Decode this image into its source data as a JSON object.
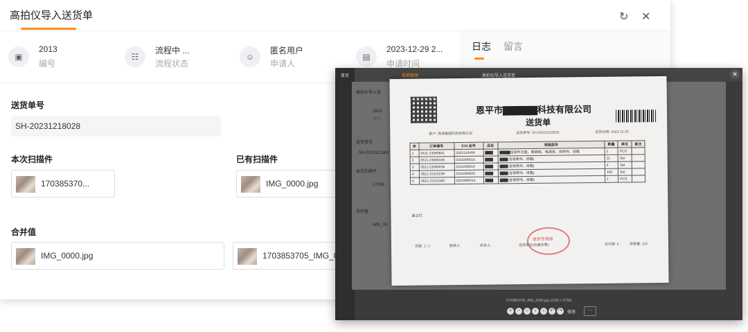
{
  "window": {
    "title": "高拍仪导入送货单",
    "refresh_icon": "refresh-icon",
    "close_icon": "close-icon"
  },
  "info": [
    {
      "value": "2013",
      "label": "编号",
      "icon": "form-icon"
    },
    {
      "value": "流程中 ...",
      "label": "流程状态",
      "icon": "flow-icon"
    },
    {
      "value": "匿名用户",
      "label": "申请人",
      "icon": "user-icon"
    },
    {
      "value": "2023-12-29 2...",
      "label": "申请时间",
      "icon": "calendar-icon"
    }
  ],
  "tabs": [
    {
      "label": "日志"
    },
    {
      "label": "留言"
    }
  ],
  "form": {
    "delivery_no_label": "送货单号",
    "delivery_no_value": "SH-20231218028",
    "current_scan_label": "本次扫描件",
    "current_scan_file": "170385370...",
    "existing_scan_label": "已有扫描件",
    "existing_scan_file": "IMG_0000.jpg",
    "merged_label": "合并值",
    "merged_files": [
      "IMG_0000.jpg",
      "1703853705_IMG_0"
    ]
  },
  "viewer": {
    "document": {
      "company": "恩平市▇▇▇▇▇科技有限公司",
      "title": "送货单",
      "customer": "客户: 珠海喜威科技有限公司",
      "delivery_no": "送货单号: SH-20231218028",
      "date": "送货日期: 2023-12-28",
      "table_headers": [
        "序",
        "订单编号",
        "E10 品号",
        "品名",
        "规格型号",
        "数量",
        "单位",
        "备注"
      ],
      "table_rows": [
        [
          "1",
          "0511-23080641",
          "2022110499",
          "▇▇▇",
          "▇▇▇▇含软件光盘、数据线、电源线、说明书、纸箱",
          "2",
          "PCS",
          ""
        ],
        [
          "2",
          "0511-23080436",
          "2011090016",
          "▇▇▇",
          "▇▇▇(含说明书、纸箱)",
          "11",
          "Set",
          ""
        ],
        [
          "3",
          "0511-23080436",
          "2011090019",
          "▇▇▇",
          "▇▇▇(含说明书、纸箱)",
          "4",
          "Set",
          ""
        ],
        [
          "4",
          "0511-23110238",
          "2011090020",
          "▇▇▇",
          "▇▇▇(含说明书、纸箱)",
          "100",
          "Set",
          ""
        ],
        [
          "5",
          "0511-23110160",
          "2022090014",
          "▇▇▇",
          "▇▇▇(含说明书、纸箱)",
          "1",
          "PCS",
          ""
        ]
      ],
      "remarks": "备注栏:",
      "page": "页数: 1 / 1",
      "maker": "制单人:",
      "receiver": "收货人:",
      "sender": "送货单位(加盖印章):",
      "stamp": "送货专用章",
      "total_rows": "总行数: 5",
      "total_qty": "总数量: 118"
    },
    "caption": "1703853705_IMG_0000.jpg (2100 × 2790)",
    "edit_label": "修改",
    "more_label": "···",
    "bg_title": "高拍仪导入送",
    "bg_no": "2013",
    "bg_no_label": "编号",
    "bg_delivery_label": "送货单号",
    "bg_delivery_value": "SH-2023121802",
    "bg_scan_label": "本次扫描件",
    "bg_scan_file": "17038",
    "bg_merged_label": "合并值",
    "bg_merged_file": "IMG_00",
    "bg_page": "首页",
    "bg_menu": "采购管理",
    "bg_tab": "高拍仪导入送货单"
  },
  "colors": {
    "accent": "#ff8a1f",
    "label_gray": "#aaaaaa"
  }
}
